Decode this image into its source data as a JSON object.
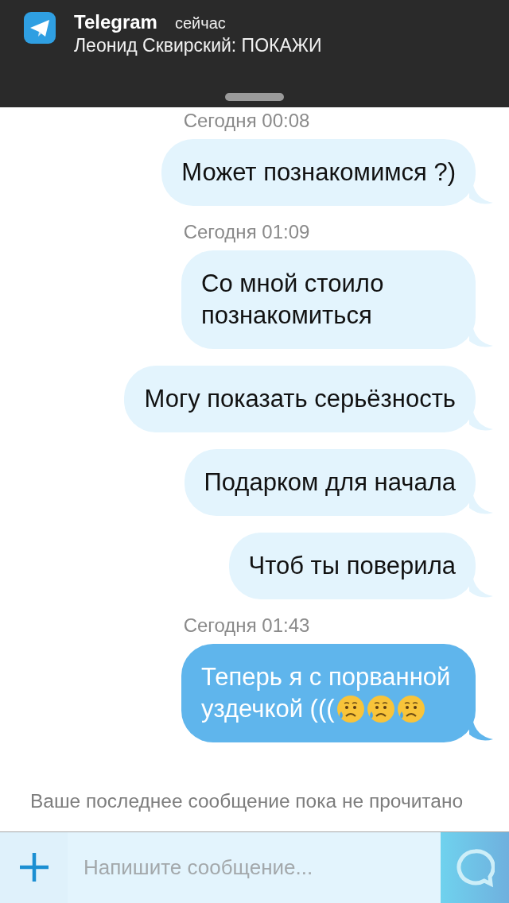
{
  "notification": {
    "app": "Telegram",
    "time": "сейчас",
    "text": "Леонид Сквирский: ПОКАЖИ"
  },
  "messages": [
    {
      "kind": "timestamp",
      "text": "Сегодня 00:08"
    },
    {
      "kind": "message",
      "text": "Может познакомимся ?)",
      "unread": false
    },
    {
      "kind": "timestamp",
      "text": "Сегодня 01:09"
    },
    {
      "kind": "message",
      "text": "Со мной стоило познакомиться",
      "unread": false
    },
    {
      "kind": "message",
      "text": "Могу показать серьёзность",
      "unread": false
    },
    {
      "kind": "message",
      "text": "Подарком для начала",
      "unread": false
    },
    {
      "kind": "message",
      "text": "Чтоб ты поверила",
      "unread": false
    },
    {
      "kind": "timestamp",
      "text": "Сегодня 01:43"
    },
    {
      "kind": "message",
      "text": "Теперь я с порванной уздечкой (((",
      "unread": true,
      "emojis": [
        {
          "kind": "sad-tear"
        },
        {
          "kind": "sad-tear"
        },
        {
          "kind": "sad-tear"
        }
      ]
    }
  ],
  "status": "Ваше последнее сообщение пока не прочитано",
  "composer": {
    "placeholder": "Напишите сообщение..."
  }
}
